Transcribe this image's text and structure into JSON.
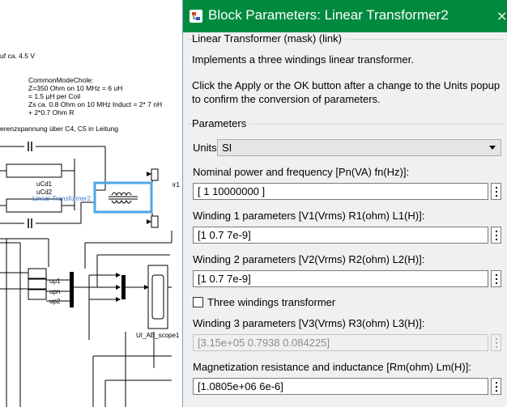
{
  "model": {
    "notes": {
      "voltage_line": "uf ca. 4.5 V",
      "cm_choke": "CommonModeChole:\nZ=350 Ohm on 10 MHz = 6 uH\n= 1.5 µH per Coil\nZs ca. 0.8 Ohm on 10 MHz Induct = 2* 7 nH\n+ 2*0.7 Ohm R",
      "diff_voltage": "erenzspannung über C4, C5 in Leitung"
    },
    "labels": {
      "ucd1": "uCd1",
      "ucd2": "uCd2",
      "transformer": "Linear Transformer2",
      "ir1": "ir1",
      "up1": "up1",
      "upn": "upn",
      "up2": "up2",
      "scope": "UI_AB_scope1"
    }
  },
  "dialog": {
    "title": "Block Parameters: Linear Transformer2",
    "close_glyph": "×",
    "mask_group_title": "Linear Transformer (mask) (link)",
    "description": "Implements a three windings linear transformer.",
    "instruction_line1": "Click the Apply or the OK button after a change to the Units popup",
    "instruction_line2": "to confirm the conversion of parameters.",
    "parameters_group_title": "Parameters",
    "units_label": "Units",
    "units_value": "SI",
    "nominal_label": "Nominal power and frequency [Pn(VA) fn(Hz)]:",
    "nominal_value": "[ 1 10000000 ]",
    "w1_label": "Winding 1 parameters [V1(Vrms) R1(ohm) L1(H)]:",
    "w1_value": "[1 0.7 7e-9]",
    "w2_label": "Winding 2 parameters [V2(Vrms) R2(ohm) L2(H)]:",
    "w2_value": "[1 0.7 7e-9]",
    "three_windings_label": "Three windings transformer",
    "three_windings_checked": false,
    "w3_label": "Winding 3 parameters [V3(Vrms) R3(ohm) L3(H)]:",
    "w3_value": "[3.15e+05 0.7938 0.084225]",
    "mag_label": "Magnetization resistance and inductance [Rm(ohm) Lm(H)]:",
    "mag_value": "[1.0805e+06 6e-6]"
  },
  "colors": {
    "titlebar": "#008a3e",
    "selection": "#4da6e8",
    "dialog_bg": "#f0f0f0"
  }
}
